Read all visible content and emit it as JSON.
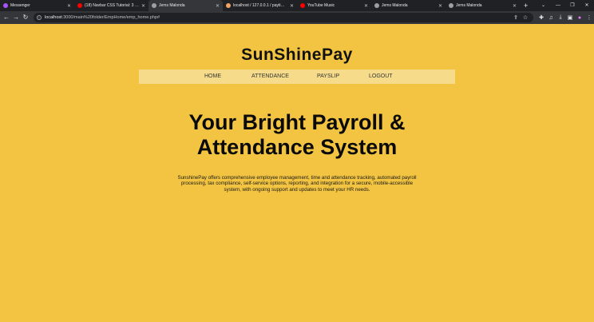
{
  "browser": {
    "tabs": [
      {
        "title": "Messenger",
        "color": "#a855f7",
        "active": false
      },
      {
        "title": "(18) Navbar CSS Tutorial: 3 Wo...",
        "color": "#ff0000",
        "active": false
      },
      {
        "title": "Jems Malonda",
        "color": "#9aa0a6",
        "active": true
      },
      {
        "title": "localhost / 127.0.0.1 / paytime...",
        "color": "#f4a261",
        "active": false
      },
      {
        "title": "YouTube Music",
        "color": "#ff0000",
        "active": false
      },
      {
        "title": "Jems Malonda",
        "color": "#9aa0a6",
        "active": false
      },
      {
        "title": "Jems Malonda",
        "color": "#9aa0a6",
        "active": false
      }
    ],
    "url_host": "localhost",
    "url_path": ":3000/main%20folder/EmpHome/emp_home.php#"
  },
  "page": {
    "brand": "SunShinePay",
    "nav": {
      "home": "HOME",
      "attendance": "ATTENDANCE",
      "payslip": "PAYSLIP",
      "logout": "LOGOUT"
    },
    "hero_line1": "Your Bright Payroll &",
    "hero_line2": "Attendance System",
    "description": "SunshinePay offers comprehensive employee management, time and attendance tracking, automated payroll processing, tax compliance, self-service options, reporting, and integration for a secure, mobile-accessible system, with ongoing support and updates to meet your HR needs."
  },
  "colors": {
    "background": "#f2c441",
    "nav_bar": "#f6dc8a"
  }
}
